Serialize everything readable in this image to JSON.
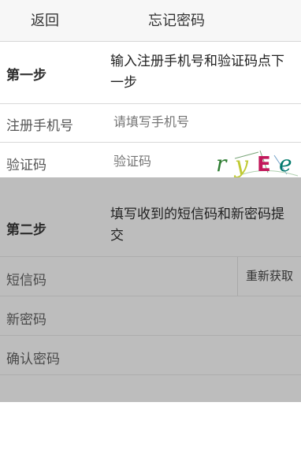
{
  "topbar": {
    "back_label": "返回",
    "title": "忘记密码"
  },
  "step1": {
    "label": "第一步",
    "description": "输入注册手机号和验证码点下一步",
    "phone": {
      "label": "注册手机号",
      "placeholder": "请填写手机号"
    },
    "verify": {
      "label": "验证码",
      "placeholder": "验证码",
      "captcha_text": "ryEe"
    }
  },
  "step2": {
    "label": "第二步",
    "description": "填写收到的短信码和新密码提交",
    "sms": {
      "label": "短信码",
      "resend_label": "重新获取"
    },
    "new_password": {
      "label": "新密码"
    },
    "confirm_password": {
      "label": "确认密码"
    }
  },
  "colors": {
    "step2_background": "#bdbdbd",
    "captcha_colors": [
      "#2e7d32",
      "#c0ca33",
      "#c2185b",
      "#00796b"
    ]
  }
}
